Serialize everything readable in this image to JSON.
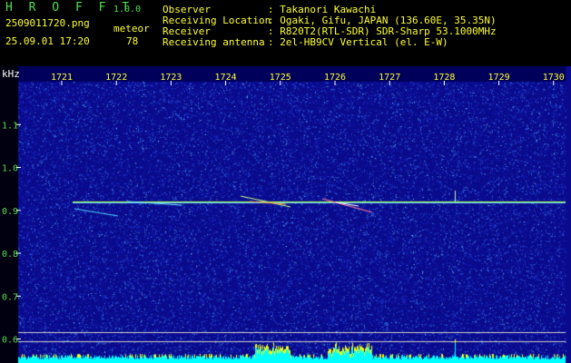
{
  "header": {
    "app_title": "H R O F F T",
    "version": "1.0.0",
    "filename": "2509011720.png",
    "timestamp": "25.09.01 17:20",
    "detection_label": "meteor",
    "detection_count": "78",
    "info_labels": [
      "Observer",
      "Receiving Location",
      "Receiver",
      "Receiving antenna"
    ],
    "info_values": [
      ": Takanori Kawachi",
      ": Ogaki, Gifu, JAPAN (136.60E, 35.35N)",
      ": R820T2(RTL-SDR) SDR-Sharp 53.1000MHz",
      ": 2el-HB9CV Vertical (el. E-W)"
    ]
  },
  "spectrogram": {
    "unit_label": "kHz",
    "x_ticks": [
      "1721",
      "1722",
      "1723",
      "1724",
      "1725",
      "1726",
      "1727",
      "1728",
      "1729",
      "1730"
    ],
    "y_ticks": [
      "1.1",
      "1.0",
      "0.9",
      "0.8",
      "0.7",
      "0.6"
    ],
    "colors": {
      "background": "#0a0a8c",
      "carrier": "#a8ff40",
      "power_bar": "#00ffff",
      "power_peak": "#ffff00",
      "label_x": "#ffff33",
      "label_y": "#4fe04f"
    }
  }
}
